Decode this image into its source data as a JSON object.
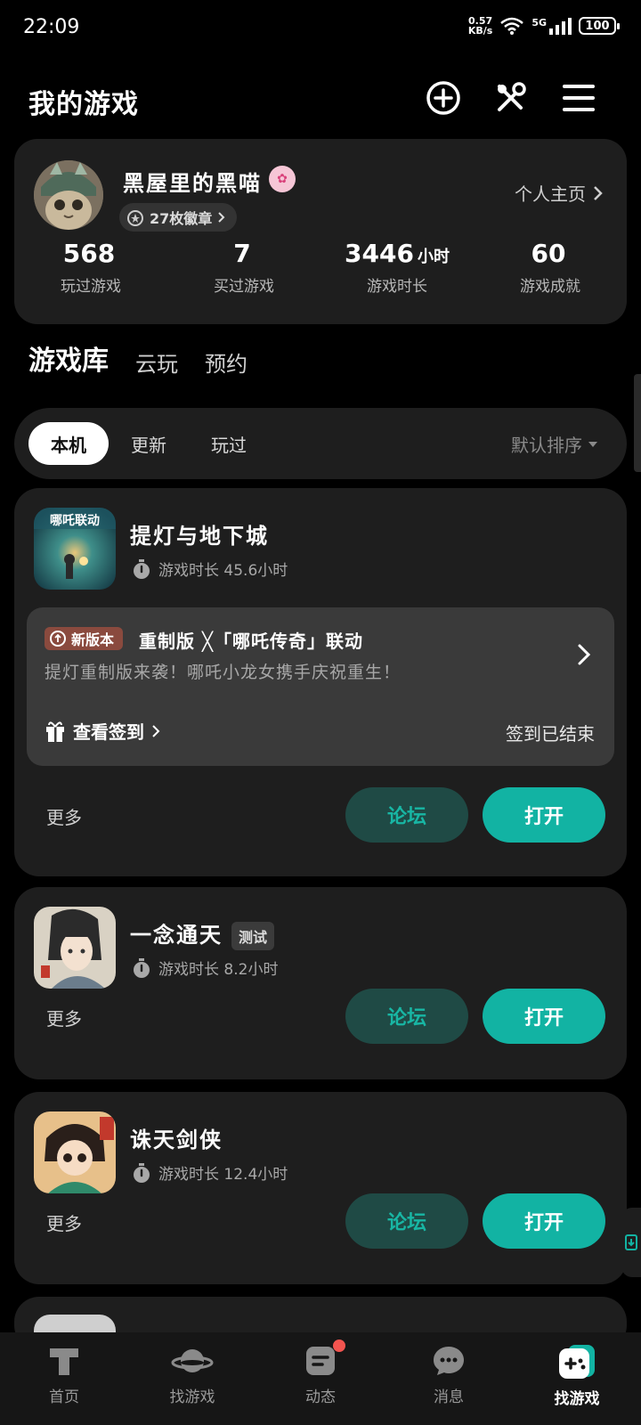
{
  "status": {
    "time": "22:09",
    "net_speed_value": "0.57",
    "net_speed_unit": "KB/s",
    "network": "5G",
    "battery": "100"
  },
  "header": {
    "title": "我的游戏"
  },
  "profile": {
    "username": "黑屋里的黑喵",
    "badges_label": "27枚徽章",
    "homepage_label": "个人主页",
    "stats": [
      {
        "value": "568",
        "unit": "",
        "label": "玩过游戏"
      },
      {
        "value": "7",
        "unit": "",
        "label": "买过游戏"
      },
      {
        "value": "3446",
        "unit": "小时",
        "label": "游戏时长"
      },
      {
        "value": "60",
        "unit": "",
        "label": "游戏成就"
      }
    ]
  },
  "tabs": [
    {
      "label": "游戏库"
    },
    {
      "label": "云玩"
    },
    {
      "label": "预约"
    }
  ],
  "filters": {
    "chips": [
      "本机",
      "更新",
      "玩过"
    ],
    "sort_label": "默认排序"
  },
  "games": [
    {
      "name": "提灯与地下城",
      "playtime": "游戏时长 45.6小时",
      "icon_text": "哪吒联动",
      "event": {
        "tag": "新版本",
        "title": "重制版 ╳「哪吒传奇」联动",
        "desc": "提灯重制版来袭！哪吒小龙女携手庆祝重生！",
        "checkin": "查看签到",
        "checkin_status": "签到已结束"
      }
    },
    {
      "name": "一念通天",
      "badge": "测试",
      "playtime": "游戏时长 8.2小时"
    },
    {
      "name": "诛天剑侠",
      "playtime": "游戏时长 12.4小时"
    }
  ],
  "card_actions": {
    "more": "更多",
    "forum": "论坛",
    "open": "打开"
  },
  "bottom_nav": [
    {
      "label": "首页",
      "icon": "home-icon"
    },
    {
      "label": "找游戏",
      "icon": "planet-icon"
    },
    {
      "label": "动态",
      "icon": "feed-icon"
    },
    {
      "label": "消息",
      "icon": "chat-icon"
    },
    {
      "label": "找游戏",
      "icon": "gamepad-icon"
    }
  ],
  "colors": {
    "accent": "#12b3a3",
    "forum_bg": "#1f4a45",
    "card_bg": "#1e1e1e",
    "notification": "#f2544f"
  }
}
